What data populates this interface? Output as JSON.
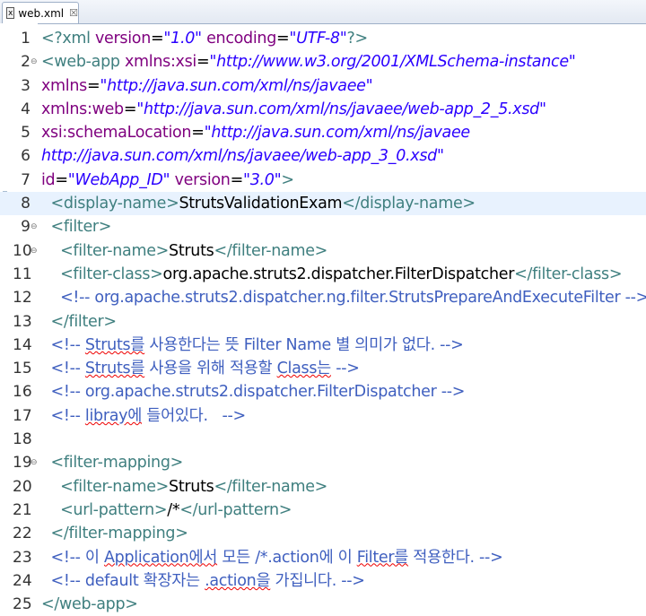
{
  "tab": {
    "title": "web.xml",
    "close": "☒"
  },
  "lines": [
    {
      "n": "1",
      "fold": "",
      "indent": "",
      "segs": [
        [
          "t",
          "<?xml "
        ],
        [
          "a",
          "version"
        ],
        [
          "x",
          "="
        ],
        [
          "v",
          "\"1.0\""
        ],
        [
          "x",
          " "
        ],
        [
          "a",
          "encoding"
        ],
        [
          "x",
          "="
        ],
        [
          "v",
          "\"UTF-8\""
        ],
        [
          "t",
          "?>"
        ]
      ]
    },
    {
      "n": "2",
      "fold": "⊖",
      "indent": "",
      "segs": [
        [
          "t",
          "<web-app "
        ],
        [
          "a",
          "xmlns:xsi"
        ],
        [
          "x",
          "="
        ],
        [
          "v",
          "\"http://www.w3.org/2001/XMLSchema-instance\""
        ]
      ]
    },
    {
      "n": "3",
      "fold": "",
      "indent": "",
      "segs": [
        [
          "a",
          "xmlns"
        ],
        [
          "x",
          "="
        ],
        [
          "v",
          "\"http://java.sun.com/xml/ns/javaee\""
        ]
      ]
    },
    {
      "n": "4",
      "fold": "",
      "indent": "",
      "segs": [
        [
          "a",
          "xmlns:web"
        ],
        [
          "x",
          "="
        ],
        [
          "v",
          "\"http://java.sun.com/xml/ns/javaee/web-app_2_5.xsd\""
        ]
      ]
    },
    {
      "n": "5",
      "fold": "",
      "indent": "",
      "segs": [
        [
          "a",
          "xsi:schemaLocation"
        ],
        [
          "x",
          "="
        ],
        [
          "v",
          "\"http://java.sun.com/xml/ns/javaee"
        ]
      ]
    },
    {
      "n": "6",
      "fold": "",
      "indent": "",
      "segs": [
        [
          "v",
          "http://java.sun.com/xml/ns/javaee/web-app_3_0.xsd\""
        ]
      ]
    },
    {
      "n": "7",
      "fold": "",
      "indent": "",
      "segs": [
        [
          "a",
          "id"
        ],
        [
          "x",
          "="
        ],
        [
          "v",
          "\"WebApp_ID\""
        ],
        [
          "x",
          " "
        ],
        [
          "a",
          "version"
        ],
        [
          "x",
          "="
        ],
        [
          "v",
          "\"3.0\""
        ],
        [
          "t",
          ">"
        ]
      ]
    },
    {
      "n": "8",
      "fold": "",
      "indent": "  ",
      "current": true,
      "segs": [
        [
          "t",
          "<display-name>"
        ],
        [
          "x",
          "StrutsValidationExam"
        ],
        [
          "t",
          "</display-name>"
        ]
      ]
    },
    {
      "n": "9",
      "fold": "⊖",
      "indent": "  ",
      "segs": [
        [
          "t",
          "<filter>"
        ]
      ]
    },
    {
      "n": "10",
      "fold": "⊖",
      "indent": "    ",
      "segs": [
        [
          "t",
          "<filter-name>"
        ],
        [
          "x",
          "Struts"
        ],
        [
          "t",
          "</filter-name>"
        ]
      ]
    },
    {
      "n": "11",
      "fold": "",
      "indent": "    ",
      "segs": [
        [
          "t",
          "<filter-class>"
        ],
        [
          "x",
          "org.apache.struts2.dispatcher.FilterDispatcher"
        ],
        [
          "t",
          "</filter-class>"
        ]
      ]
    },
    {
      "n": "12",
      "fold": "",
      "indent": "    ",
      "segs": [
        [
          "c",
          "<!-- org.apache.struts2.dispatcher.ng.filter.StrutsPrepareAndExecuteFilter -->"
        ]
      ]
    },
    {
      "n": "13",
      "fold": "",
      "indent": "  ",
      "segs": [
        [
          "t",
          "</filter>"
        ]
      ]
    },
    {
      "n": "14",
      "fold": "",
      "indent": "  ",
      "segs": [
        [
          "c",
          "<!-- "
        ],
        [
          "csq",
          "Struts를"
        ],
        [
          "c",
          " 사용한다는 뜻 Filter Name 별 의미가 없다. -->"
        ]
      ]
    },
    {
      "n": "15",
      "fold": "",
      "indent": "  ",
      "segs": [
        [
          "c",
          "<!-- "
        ],
        [
          "csq",
          "Struts를"
        ],
        [
          "c",
          " 사용을 위해 적용할 "
        ],
        [
          "csq",
          "Class는"
        ],
        [
          "c",
          " -->"
        ]
      ]
    },
    {
      "n": "16",
      "fold": "",
      "indent": "  ",
      "segs": [
        [
          "c",
          "<!-- org.apache.struts2.dispatcher.FilterDispatcher -->"
        ]
      ]
    },
    {
      "n": "17",
      "fold": "",
      "indent": "  ",
      "segs": [
        [
          "c",
          "<!-- "
        ],
        [
          "csq",
          "libray에"
        ],
        [
          "c",
          " 들어있다.   -->"
        ]
      ]
    },
    {
      "n": "18",
      "fold": "",
      "indent": "",
      "segs": []
    },
    {
      "n": "19",
      "fold": "⊖",
      "indent": "  ",
      "segs": [
        [
          "t",
          "<filter-mapping>"
        ]
      ]
    },
    {
      "n": "20",
      "fold": "",
      "indent": "    ",
      "segs": [
        [
          "t",
          "<filter-name>"
        ],
        [
          "x",
          "Struts"
        ],
        [
          "t",
          "</filter-name>"
        ]
      ]
    },
    {
      "n": "21",
      "fold": "",
      "indent": "    ",
      "segs": [
        [
          "t",
          "<url-pattern>"
        ],
        [
          "x",
          "/*"
        ],
        [
          "t",
          "</url-pattern>"
        ]
      ]
    },
    {
      "n": "22",
      "fold": "",
      "indent": "  ",
      "segs": [
        [
          "t",
          "</filter-mapping>"
        ]
      ]
    },
    {
      "n": "23",
      "fold": "",
      "indent": "  ",
      "segs": [
        [
          "c",
          "<!-- 이 "
        ],
        [
          "csq",
          "Application에서"
        ],
        [
          "c",
          " 모든 /*.action에 이 "
        ],
        [
          "csq",
          "Filter를"
        ],
        [
          "c",
          " 적용한다. -->"
        ]
      ]
    },
    {
      "n": "24",
      "fold": "",
      "indent": "  ",
      "segs": [
        [
          "c",
          "<!-- default 확장자는 "
        ],
        [
          "csq",
          ".action을"
        ],
        [
          "c",
          " 가집니다. -->"
        ]
      ]
    },
    {
      "n": "25",
      "fold": "",
      "indent": "",
      "segs": [
        [
          "t",
          "</web-app>"
        ]
      ]
    }
  ],
  "colors": {
    "tag": "#3f7f7f",
    "attr": "#7f007f",
    "value": "#2a00ff",
    "comment": "#3f5fbf",
    "text": "#000000",
    "current_line": "#e8f2fe"
  }
}
